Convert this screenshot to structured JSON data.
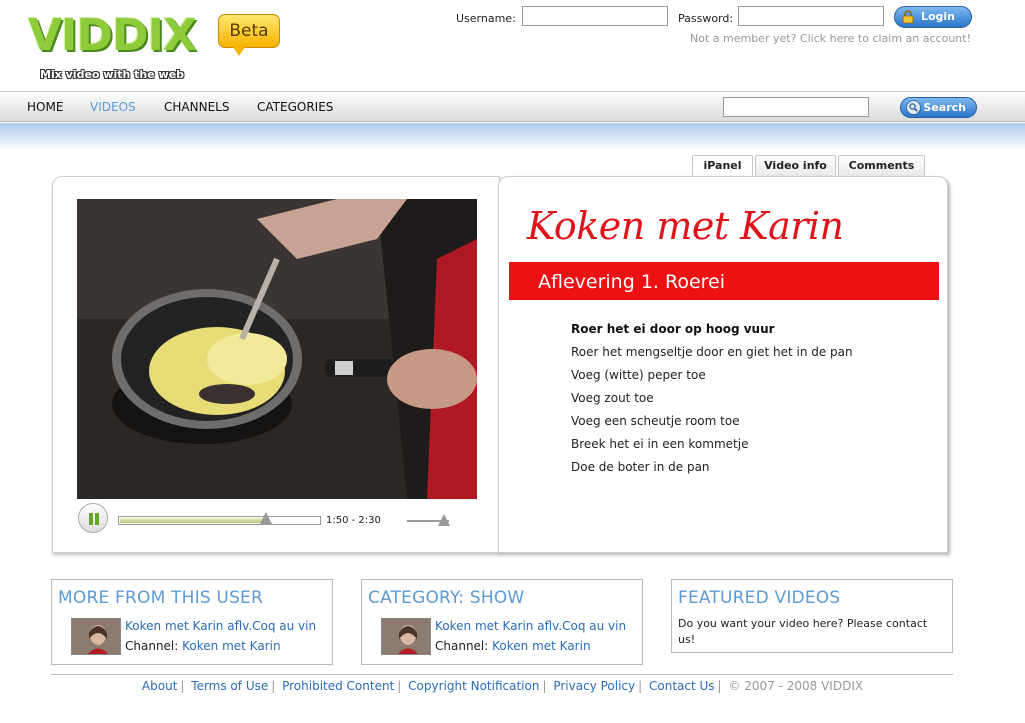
{
  "header": {
    "logo_text": "VIDDIX",
    "logo_tagline": "Mix video with the web",
    "beta_label": "Beta",
    "username_label": "Username:",
    "password_label": "Password:",
    "login_label": "Login",
    "member_text": "Not a member yet? Click here to claim an account!"
  },
  "nav": {
    "items": [
      {
        "label": "HOME",
        "active": false
      },
      {
        "label": "VIDEOS",
        "active": true
      },
      {
        "label": "CHANNELS",
        "active": false
      },
      {
        "label": "CATEGORIES",
        "active": false
      }
    ],
    "search_label": "Search",
    "search_value": ""
  },
  "tabs": [
    {
      "label": "iPanel",
      "active": true
    },
    {
      "label": "Video info",
      "active": false
    },
    {
      "label": "Comments",
      "active": false
    }
  ],
  "player": {
    "time_display": "1:50 - 2:30",
    "progress_fraction": 0.73,
    "volume_fraction": 0.85,
    "state": "playing"
  },
  "ipanel": {
    "show_title": "Koken met Karin",
    "episode": "Aflevering 1. Roerei",
    "steps": [
      {
        "text": "Roer het ei door op hoog vuur",
        "current": true
      },
      {
        "text": "Roer het mengseltje door en giet het in de pan",
        "current": false
      },
      {
        "text": "Voeg (witte) peper toe",
        "current": false
      },
      {
        "text": "Voeg zout toe",
        "current": false
      },
      {
        "text": "Voeg een scheutje room toe",
        "current": false
      },
      {
        "text": "Breek het ei in een kommetje",
        "current": false
      },
      {
        "text": "Doe de boter in de pan",
        "current": false
      }
    ]
  },
  "boxes": {
    "more_from_user": {
      "title": "MORE FROM THIS USER",
      "link": "Koken met Karin aflv.Coq au vin",
      "channel_label": "Channel:",
      "channel_link": "Koken met Karin"
    },
    "category": {
      "title": "CATEGORY: SHOW",
      "link": "Koken met Karin aflv.Coq au vin",
      "channel_label": "Channel:",
      "channel_link": "Koken met Karin"
    },
    "featured": {
      "title": "FEATURED VIDEOS",
      "text": "Do you want your video here? Please contact us!"
    }
  },
  "footer": {
    "links": [
      "About",
      "Terms of Use",
      "Prohibited Content",
      "Copyright Notification",
      "Privacy Policy",
      "Contact Us"
    ],
    "copyright": "© 2007 - 2008 VIDDIX"
  },
  "colors": {
    "accent_blue": "#5c9bd6",
    "link_blue": "#2a6db7",
    "brand_green": "#8fcc3c",
    "show_red": "#ee1114"
  }
}
